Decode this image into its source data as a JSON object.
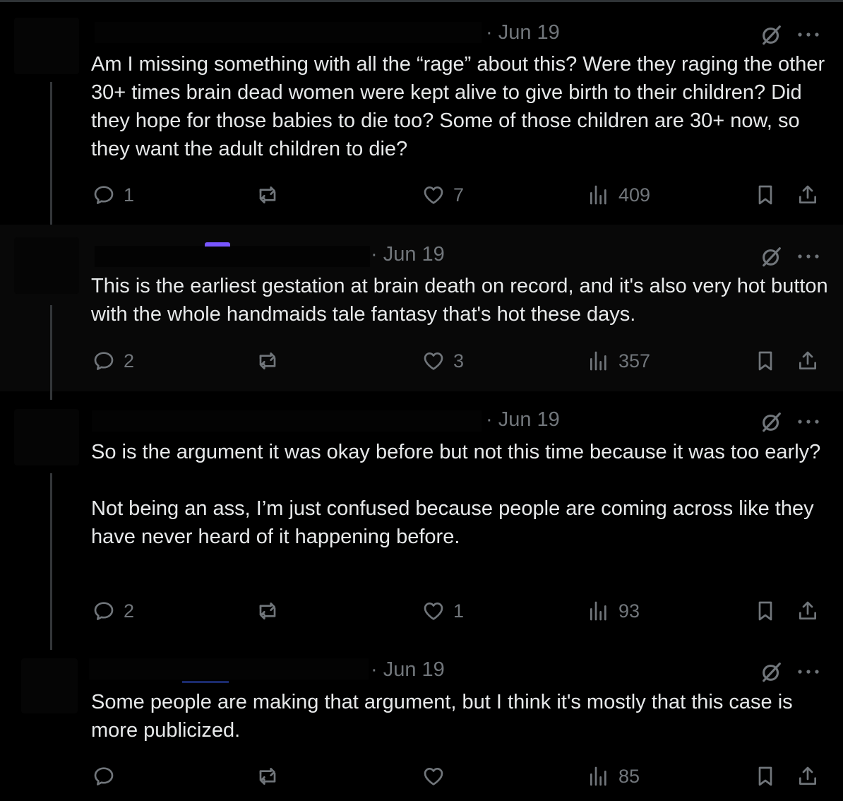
{
  "posts": [
    {
      "date": "· Jun 19",
      "text": "Am I missing something with all the “rage” about this? Were they raging the other 30+ times brain dead women were kept alive to give birth to their children? Did they hope for those babies to die too? Some of those children are 30+ now, so they want the adult children to die?",
      "replies": "1",
      "reposts": "",
      "likes": "7",
      "views": "409"
    },
    {
      "date": "· Jun 19",
      "text": "This is the earliest gestation at brain death on record, and it's also very hot button with the whole handmaids tale fantasy that's hot these days.",
      "replies": "2",
      "reposts": "",
      "likes": "3",
      "views": "357"
    },
    {
      "date": "· Jun 19",
      "text": "So is the argument it was okay before but not this time because it was too early?\n\nNot being an ass, I’m just confused because people are coming across like they have never heard of it happening before.",
      "replies": "2",
      "reposts": "",
      "likes": "1",
      "views": "93"
    },
    {
      "date": "· Jun 19",
      "text": "Some people are making that argument, but I think it's mostly that this case is more publicized.",
      "replies": "",
      "reposts": "",
      "likes": "",
      "views": "85"
    }
  ],
  "icons": {
    "reply": "reply-icon",
    "repost": "repost-icon",
    "like": "heart-icon",
    "views": "views-icon",
    "bookmark": "bookmark-icon",
    "share": "share-icon",
    "grok": "grok-icon",
    "more": "more-icon"
  },
  "colors": {
    "background": "#000000",
    "text": "#e7e9ea",
    "muted": "#71767b",
    "line": "#333639",
    "highlight": "#080808"
  }
}
